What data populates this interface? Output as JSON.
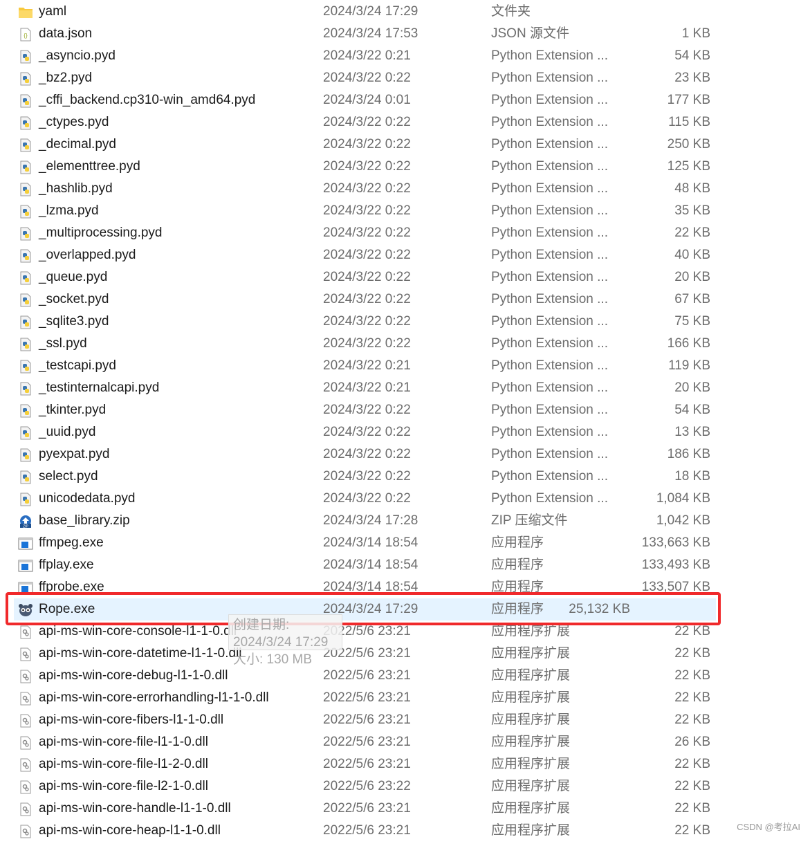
{
  "files": [
    {
      "name": "yaml",
      "date": "2024/3/24 17:29",
      "type": "文件夹",
      "size": "",
      "icon": "folder"
    },
    {
      "name": "data.json",
      "date": "2024/3/24 17:53",
      "type": "JSON 源文件",
      "size": "1 KB",
      "icon": "json"
    },
    {
      "name": "_asyncio.pyd",
      "date": "2024/3/22 0:21",
      "type": "Python Extension ...",
      "size": "54 KB",
      "icon": "python"
    },
    {
      "name": "_bz2.pyd",
      "date": "2024/3/22 0:22",
      "type": "Python Extension ...",
      "size": "23 KB",
      "icon": "python"
    },
    {
      "name": "_cffi_backend.cp310-win_amd64.pyd",
      "date": "2024/3/24 0:01",
      "type": "Python Extension ...",
      "size": "177 KB",
      "icon": "python"
    },
    {
      "name": "_ctypes.pyd",
      "date": "2024/3/22 0:22",
      "type": "Python Extension ...",
      "size": "115 KB",
      "icon": "python"
    },
    {
      "name": "_decimal.pyd",
      "date": "2024/3/22 0:22",
      "type": "Python Extension ...",
      "size": "250 KB",
      "icon": "python"
    },
    {
      "name": "_elementtree.pyd",
      "date": "2024/3/22 0:22",
      "type": "Python Extension ...",
      "size": "125 KB",
      "icon": "python"
    },
    {
      "name": "_hashlib.pyd",
      "date": "2024/3/22 0:22",
      "type": "Python Extension ...",
      "size": "48 KB",
      "icon": "python"
    },
    {
      "name": "_lzma.pyd",
      "date": "2024/3/22 0:22",
      "type": "Python Extension ...",
      "size": "35 KB",
      "icon": "python"
    },
    {
      "name": "_multiprocessing.pyd",
      "date": "2024/3/22 0:22",
      "type": "Python Extension ...",
      "size": "22 KB",
      "icon": "python"
    },
    {
      "name": "_overlapped.pyd",
      "date": "2024/3/22 0:22",
      "type": "Python Extension ...",
      "size": "40 KB",
      "icon": "python"
    },
    {
      "name": "_queue.pyd",
      "date": "2024/3/22 0:22",
      "type": "Python Extension ...",
      "size": "20 KB",
      "icon": "python"
    },
    {
      "name": "_socket.pyd",
      "date": "2024/3/22 0:22",
      "type": "Python Extension ...",
      "size": "67 KB",
      "icon": "python"
    },
    {
      "name": "_sqlite3.pyd",
      "date": "2024/3/22 0:22",
      "type": "Python Extension ...",
      "size": "75 KB",
      "icon": "python"
    },
    {
      "name": "_ssl.pyd",
      "date": "2024/3/22 0:22",
      "type": "Python Extension ...",
      "size": "166 KB",
      "icon": "python"
    },
    {
      "name": "_testcapi.pyd",
      "date": "2024/3/22 0:21",
      "type": "Python Extension ...",
      "size": "119 KB",
      "icon": "python"
    },
    {
      "name": "_testinternalcapi.pyd",
      "date": "2024/3/22 0:21",
      "type": "Python Extension ...",
      "size": "20 KB",
      "icon": "python"
    },
    {
      "name": "_tkinter.pyd",
      "date": "2024/3/22 0:22",
      "type": "Python Extension ...",
      "size": "54 KB",
      "icon": "python"
    },
    {
      "name": "_uuid.pyd",
      "date": "2024/3/22 0:22",
      "type": "Python Extension ...",
      "size": "13 KB",
      "icon": "python"
    },
    {
      "name": "pyexpat.pyd",
      "date": "2024/3/22 0:22",
      "type": "Python Extension ...",
      "size": "186 KB",
      "icon": "python"
    },
    {
      "name": "select.pyd",
      "date": "2024/3/22 0:22",
      "type": "Python Extension ...",
      "size": "18 KB",
      "icon": "python"
    },
    {
      "name": "unicodedata.pyd",
      "date": "2024/3/22 0:22",
      "type": "Python Extension ...",
      "size": "1,084 KB",
      "icon": "python"
    },
    {
      "name": "base_library.zip",
      "date": "2024/3/24 17:28",
      "type": "ZIP 压缩文件",
      "size": "1,042 KB",
      "icon": "zip"
    },
    {
      "name": "ffmpeg.exe",
      "date": "2024/3/14 18:54",
      "type": "应用程序",
      "size": "133,663 KB",
      "icon": "exe"
    },
    {
      "name": "ffplay.exe",
      "date": "2024/3/14 18:54",
      "type": "应用程序",
      "size": "133,493 KB",
      "icon": "exe"
    },
    {
      "name": "ffprobe.exe",
      "date": "2024/3/14 18:54",
      "type": "应用程序",
      "size": "133,507 KB",
      "icon": "exe"
    },
    {
      "name": "Rope.exe",
      "date": "2024/3/24 17:29",
      "type": "应用程序",
      "size": "25,132 KB",
      "icon": "rope",
      "selected": true
    },
    {
      "name": "api-ms-win-core-console-l1-1-0.dll",
      "date": "2022/5/6 23:21",
      "type": "应用程序扩展",
      "size": "22 KB",
      "icon": "dll"
    },
    {
      "name": "api-ms-win-core-datetime-l1-1-0.dll",
      "date": "2022/5/6 23:21",
      "type": "应用程序扩展",
      "size": "22 KB",
      "icon": "dll"
    },
    {
      "name": "api-ms-win-core-debug-l1-1-0.dll",
      "date": "2022/5/6 23:21",
      "type": "应用程序扩展",
      "size": "22 KB",
      "icon": "dll"
    },
    {
      "name": "api-ms-win-core-errorhandling-l1-1-0.dll",
      "date": "2022/5/6 23:21",
      "type": "应用程序扩展",
      "size": "22 KB",
      "icon": "dll"
    },
    {
      "name": "api-ms-win-core-fibers-l1-1-0.dll",
      "date": "2022/5/6 23:21",
      "type": "应用程序扩展",
      "size": "22 KB",
      "icon": "dll"
    },
    {
      "name": "api-ms-win-core-file-l1-1-0.dll",
      "date": "2022/5/6 23:21",
      "type": "应用程序扩展",
      "size": "26 KB",
      "icon": "dll"
    },
    {
      "name": "api-ms-win-core-file-l1-2-0.dll",
      "date": "2022/5/6 23:21",
      "type": "应用程序扩展",
      "size": "22 KB",
      "icon": "dll"
    },
    {
      "name": "api-ms-win-core-file-l2-1-0.dll",
      "date": "2022/5/6 23:22",
      "type": "应用程序扩展",
      "size": "22 KB",
      "icon": "dll"
    },
    {
      "name": "api-ms-win-core-handle-l1-1-0.dll",
      "date": "2022/5/6 23:21",
      "type": "应用程序扩展",
      "size": "22 KB",
      "icon": "dll"
    },
    {
      "name": "api-ms-win-core-heap-l1-1-0.dll",
      "date": "2022/5/6 23:21",
      "type": "应用程序扩展",
      "size": "22 KB",
      "icon": "dll"
    }
  ],
  "tooltip": {
    "created": "创建日期: 2024/3/24 17:29",
    "size": "大小: 130 MB"
  },
  "watermark": "CSDN @考拉AI",
  "colors": {
    "selection": "#e5f3ff",
    "highlight_box": "#f0292b"
  }
}
